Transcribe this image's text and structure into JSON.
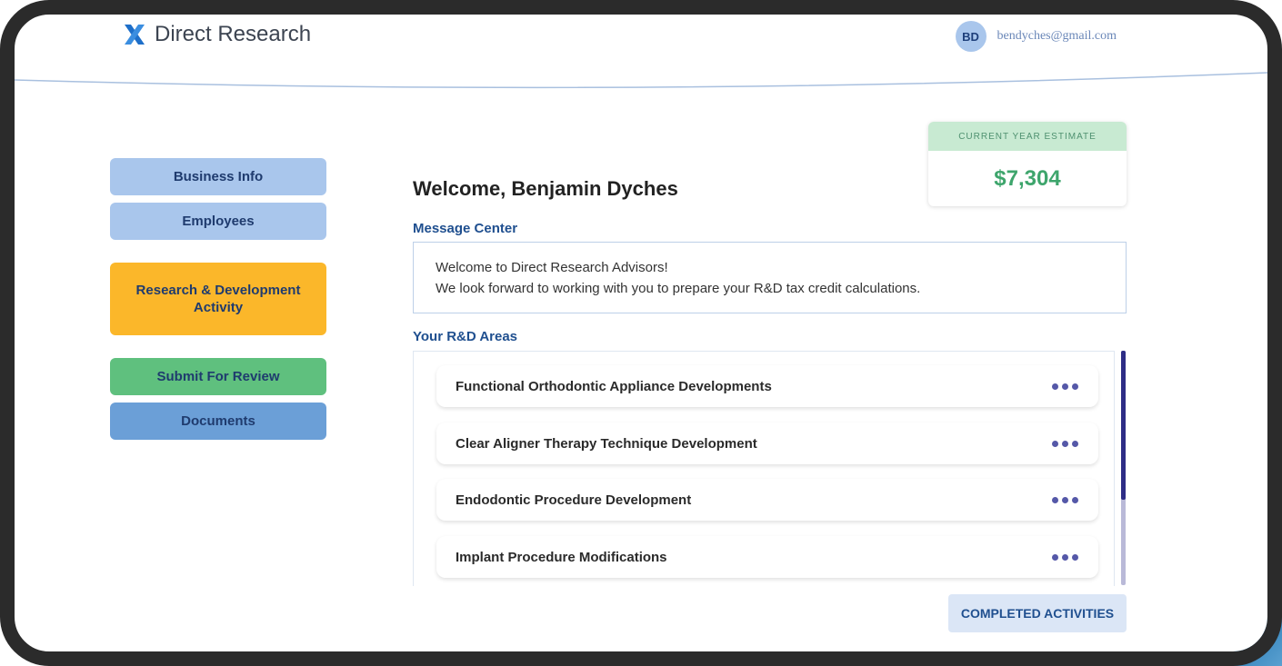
{
  "header": {
    "logo_text": "Direct Research",
    "user_initials": "BD",
    "user_email": "bendyches@gmail.com"
  },
  "sidebar": {
    "items": [
      {
        "label": "Business Info",
        "color": "#a9c6ec"
      },
      {
        "label": "Employees",
        "color": "#a9c6ec"
      },
      {
        "label": "Research & Development Activity",
        "color": "#fbb72a"
      },
      {
        "label": "Submit For Review",
        "color": "#5fc07e"
      },
      {
        "label": "Documents",
        "color": "#6b9fd7"
      }
    ]
  },
  "estimate": {
    "label": "CURRENT YEAR ESTIMATE",
    "value": "$7,304"
  },
  "main": {
    "welcome": "Welcome, Benjamin Dyches",
    "message_center_label": "Message Center",
    "messages": [
      "Welcome to Direct Research Advisors!",
      "We look forward to working with you to prepare your R&D tax credit calculations."
    ],
    "rd_areas_label": "Your R&D Areas",
    "rd_areas": [
      {
        "title": "Functional Orthodontic Appliance Developments",
        "menu_icon": "more-dots-icon"
      },
      {
        "title": "Clear Aligner Therapy Technique Development",
        "menu_icon": "more-dots-icon"
      },
      {
        "title": "Endodontic Procedure Development",
        "menu_icon": "more-dots-icon"
      },
      {
        "title": "Implant Procedure Modifications",
        "menu_icon": "more-dots-icon"
      }
    ],
    "completed_button": "COMPLETED ACTIVITIES"
  },
  "colors": {
    "brand_blue": "#1e6fc9",
    "estimate_green": "#3ea56c",
    "scroll_thumb": "#2e2d86"
  }
}
